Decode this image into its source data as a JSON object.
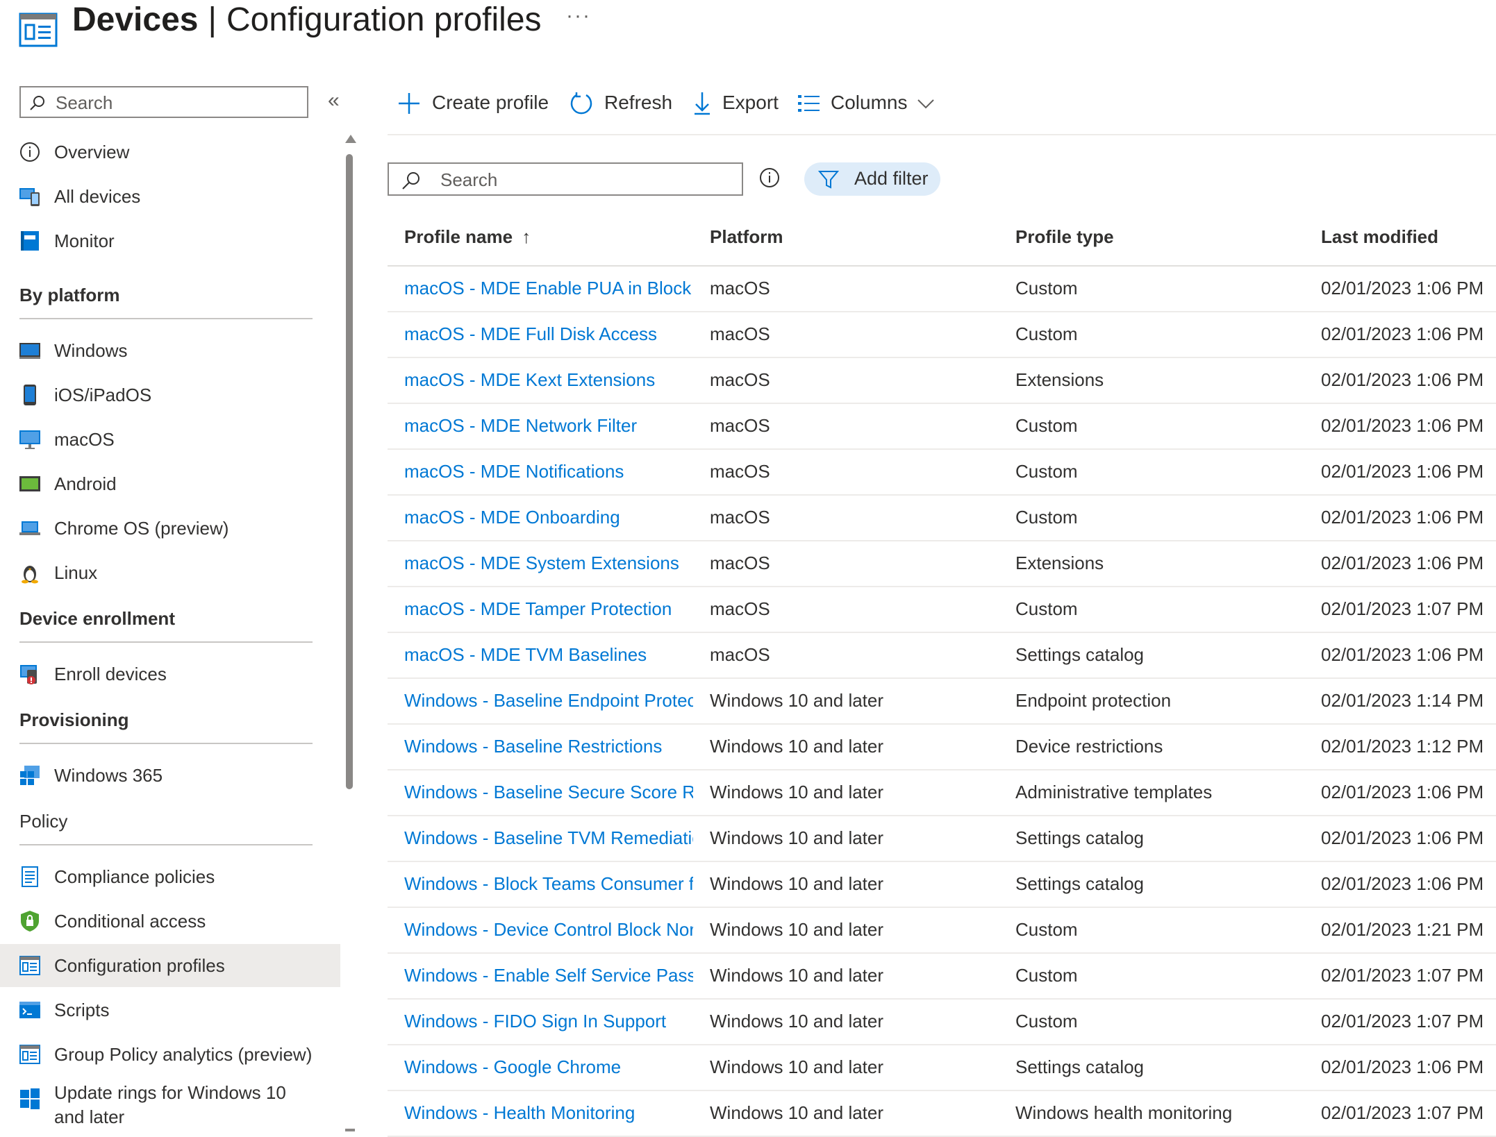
{
  "header": {
    "title_bold": "Devices",
    "separator": "|",
    "title_rest": "Configuration profiles",
    "more_label": "···",
    "icon": "configuration-profiles-icon"
  },
  "sidebar": {
    "search_placeholder": "Search",
    "collapse_label": "«",
    "top_items": [
      {
        "label": "Overview",
        "icon": "info-icon"
      },
      {
        "label": "All devices",
        "icon": "all-devices-icon"
      },
      {
        "label": "Monitor",
        "icon": "monitor-icon"
      }
    ],
    "sections": [
      {
        "title": "By platform",
        "items": [
          {
            "label": "Windows",
            "icon": "windows-device-icon"
          },
          {
            "label": "iOS/iPadOS",
            "icon": "ios-device-icon"
          },
          {
            "label": "macOS",
            "icon": "macos-device-icon"
          },
          {
            "label": "Android",
            "icon": "android-device-icon"
          },
          {
            "label": "Chrome OS (preview)",
            "icon": "chromeos-device-icon"
          },
          {
            "label": "Linux",
            "icon": "linux-icon"
          }
        ]
      },
      {
        "title": "Device enrollment",
        "items": [
          {
            "label": "Enroll devices",
            "icon": "enroll-devices-icon"
          }
        ]
      },
      {
        "title": "Provisioning",
        "items": [
          {
            "label": "Windows 365",
            "icon": "windows-365-icon"
          }
        ]
      },
      {
        "title": "Policy",
        "items": [
          {
            "label": "Compliance policies",
            "icon": "compliance-icon"
          },
          {
            "label": "Conditional access",
            "icon": "shield-lock-icon"
          },
          {
            "label": "Configuration profiles",
            "icon": "configuration-profiles-icon",
            "active": true
          },
          {
            "label": "Scripts",
            "icon": "scripts-icon"
          },
          {
            "label": "Group Policy analytics (preview)",
            "icon": "group-policy-icon"
          },
          {
            "label": "Update rings for Windows 10 and later",
            "line1": "Update rings for Windows 10",
            "line2": "and later",
            "icon": "windows-logo-icon"
          }
        ]
      }
    ]
  },
  "toolbar": {
    "create_label": "Create profile",
    "refresh_label": "Refresh",
    "export_label": "Export",
    "columns_label": "Columns"
  },
  "filters": {
    "search_placeholder": "Search",
    "add_filter_label": "Add filter"
  },
  "table": {
    "columns": [
      "Profile name",
      "Platform",
      "Profile type",
      "Last modified"
    ],
    "sort_indicator": "↑",
    "rows": [
      {
        "name": "macOS - MDE Enable PUA in Block M",
        "platform": "macOS",
        "type": "Custom",
        "modified": "02/01/2023 1:06 PM"
      },
      {
        "name": "macOS - MDE Full Disk Access",
        "platform": "macOS",
        "type": "Custom",
        "modified": "02/01/2023 1:06 PM"
      },
      {
        "name": "macOS - MDE Kext Extensions",
        "platform": "macOS",
        "type": "Extensions",
        "modified": "02/01/2023 1:06 PM"
      },
      {
        "name": "macOS - MDE Network Filter",
        "platform": "macOS",
        "type": "Custom",
        "modified": "02/01/2023 1:06 PM"
      },
      {
        "name": "macOS - MDE Notifications",
        "platform": "macOS",
        "type": "Custom",
        "modified": "02/01/2023 1:06 PM"
      },
      {
        "name": "macOS - MDE Onboarding",
        "platform": "macOS",
        "type": "Custom",
        "modified": "02/01/2023 1:06 PM"
      },
      {
        "name": "macOS - MDE System Extensions",
        "platform": "macOS",
        "type": "Extensions",
        "modified": "02/01/2023 1:06 PM"
      },
      {
        "name": "macOS - MDE Tamper Protection",
        "platform": "macOS",
        "type": "Custom",
        "modified": "02/01/2023 1:07 PM"
      },
      {
        "name": "macOS - MDE TVM Baselines",
        "platform": "macOS",
        "type": "Settings catalog",
        "modified": "02/01/2023 1:06 PM"
      },
      {
        "name": "Windows - Baseline Endpoint Protec",
        "platform": "Windows 10 and later",
        "type": "Endpoint protection",
        "modified": "02/01/2023 1:14 PM"
      },
      {
        "name": "Windows - Baseline Restrictions",
        "platform": "Windows 10 and later",
        "type": "Device restrictions",
        "modified": "02/01/2023 1:12 PM"
      },
      {
        "name": "Windows - Baseline Secure Score Re",
        "platform": "Windows 10 and later",
        "type": "Administrative templates",
        "modified": "02/01/2023 1:06 PM"
      },
      {
        "name": "Windows - Baseline TVM Remediatic",
        "platform": "Windows 10 and later",
        "type": "Settings catalog",
        "modified": "02/01/2023 1:06 PM"
      },
      {
        "name": "Windows - Block Teams Consumer fr",
        "platform": "Windows 10 and later",
        "type": "Settings catalog",
        "modified": "02/01/2023 1:06 PM"
      },
      {
        "name": "Windows - Device Control Block Nor",
        "platform": "Windows 10 and later",
        "type": "Custom",
        "modified": "02/01/2023 1:21 PM"
      },
      {
        "name": "Windows - Enable Self Service Passw",
        "platform": "Windows 10 and later",
        "type": "Custom",
        "modified": "02/01/2023 1:07 PM"
      },
      {
        "name": "Windows - FIDO Sign In Support",
        "platform": "Windows 10 and later",
        "type": "Custom",
        "modified": "02/01/2023 1:07 PM"
      },
      {
        "name": "Windows - Google Chrome",
        "platform": "Windows 10 and later",
        "type": "Settings catalog",
        "modified": "02/01/2023 1:06 PM"
      },
      {
        "name": "Windows - Health Monitoring",
        "platform": "Windows 10 and later",
        "type": "Windows health monitoring",
        "modified": "02/01/2023 1:07 PM"
      }
    ]
  },
  "colors": {
    "link": "#0078d4",
    "active_nav_bg": "#edebe9",
    "filter_pill_bg": "#deecf9"
  }
}
